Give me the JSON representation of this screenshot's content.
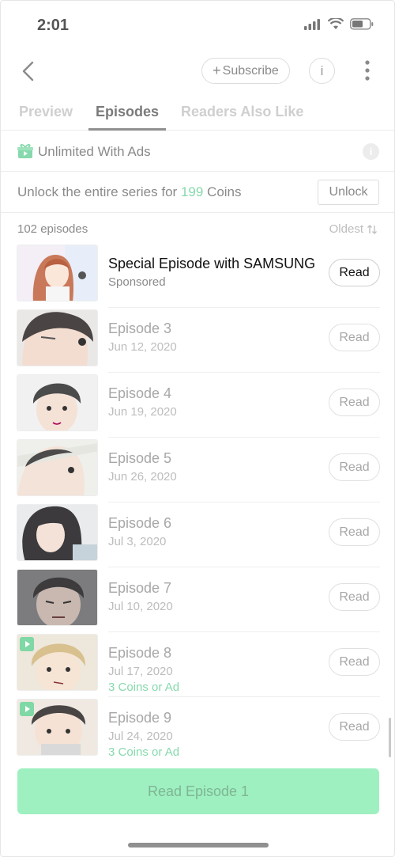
{
  "status_bar": {
    "time": "2:01"
  },
  "nav": {
    "subscribe_label": "Subscribe",
    "info_label": "i"
  },
  "tabs": [
    {
      "label": "Preview",
      "active": false
    },
    {
      "label": "Episodes",
      "active": true
    },
    {
      "label": "Readers Also Like",
      "active": false
    }
  ],
  "unlimited": {
    "label": "Unlimited With Ads",
    "info": "i"
  },
  "unlock": {
    "prefix": "Unlock the entire series for",
    "coins": "199",
    "suffix": "Coins",
    "button": "Unlock"
  },
  "list": {
    "count": "102 episodes",
    "sort_label": "Oldest",
    "sort_icon": "sort-arrows-icon"
  },
  "episodes": [
    {
      "title": "Special Episode with SAMSUNG",
      "date": "Sponsored",
      "promo": "",
      "read": "Read",
      "sponsored": true,
      "thumb": "ep-special"
    },
    {
      "title": "Episode 3",
      "date": "Jun 12, 2020",
      "promo": "",
      "read": "Read",
      "thumb": "ep3"
    },
    {
      "title": "Episode 4",
      "date": "Jun 19, 2020",
      "promo": "",
      "read": "Read",
      "thumb": "ep4"
    },
    {
      "title": "Episode 5",
      "date": "Jun 26, 2020",
      "promo": "",
      "read": "Read",
      "thumb": "ep5"
    },
    {
      "title": "Episode 6",
      "date": "Jul 3, 2020",
      "promo": "",
      "read": "Read",
      "thumb": "ep6"
    },
    {
      "title": "Episode 7",
      "date": "Jul 10, 2020",
      "promo": "",
      "read": "Read",
      "thumb": "ep7"
    },
    {
      "title": "Episode 8",
      "date": "Jul 17, 2020",
      "promo": "3 Coins or Ad",
      "read": "Read",
      "thumb": "ep8"
    },
    {
      "title": "Episode 9",
      "date": "Jul 24, 2020",
      "promo": "3 Coins or Ad",
      "read": "Read",
      "thumb": "ep9"
    }
  ],
  "cta": {
    "label": "Read Episode 1"
  },
  "colors": {
    "accent": "#86d9ac",
    "cta_bg": "#9ef0c0"
  }
}
